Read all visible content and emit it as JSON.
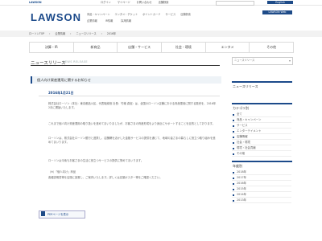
{
  "topbar": {
    "logo": "LAWSON",
    "links": [
      "ログイン",
      "マイページ",
      "お問い合わせ",
      "店舗検索"
    ],
    "en_label": "English"
  },
  "header": {
    "logo": "LAWSON",
    "nav": [
      "商品・キャンペーン",
      "エンタメ・チケット",
      "ポイントカード",
      "サービス",
      "店舗検索"
    ],
    "subnav": [
      "企業情報",
      "IR情報",
      "採用情報"
    ],
    "en_label": "LAWSON Web"
  },
  "breadcrumb": [
    "ローソンTOP",
    "企業情報",
    "ニュースリリース",
    "2016年"
  ],
  "tabs": [
    "決算・IR",
    "新商品",
    "店舗・サービス",
    "社会・環境",
    "エンタメ",
    "その他"
  ],
  "main": {
    "section_title": "ニュースリリース",
    "section_sub": "NEWS RELEASE",
    "article_title": "個人向け資産運用に関するお知らせ",
    "date": "2016年1月21日",
    "paragraphs": [
      "株式会社ローソン（本社：東京都品川区、代表取締役 社長：竹増 貞信）は、全国のローソン店舗における資産運用に関する販売を、2016年2月に開始いたします。",
      "これまで個人向け資産運用の取り扱いを進めてまいりましたが、お客さまの資産形成をより身近にサポートすることを目的としております。",
      "ローソンは、株式会社ローソン銀行と連携し、店舗網を活かした金融サービスの提供を通じて、地域の皆さまの暮らしに役立つ取り組みを進めてまいります。",
      "ローソンは今後もお客さまの生活に役立つサービスの提供に努めてまいります。",
      "（※）「個人向け」商品",
      "各種説明書等を店頭に設置し、ご案内いたします。詳しくは店頭ポスター等をご確認ください。"
    ],
    "pdf_label": "PDFページを表示"
  },
  "sidebar": {
    "select_placeholder": "ニュースリリース",
    "categories_title": "カテゴリ別",
    "categories": [
      "全て",
      "商品・キャンペーン",
      "サービス",
      "エンターテイメント",
      "店舗情報",
      "社会・環境",
      "環境・社会貢献",
      "その他"
    ],
    "years_title": "年度別",
    "years": [
      "2018年",
      "2017年",
      "2016年",
      "2015年",
      "2014年",
      "2013年"
    ]
  },
  "colors": {
    "brand": "#1c4a8a"
  }
}
